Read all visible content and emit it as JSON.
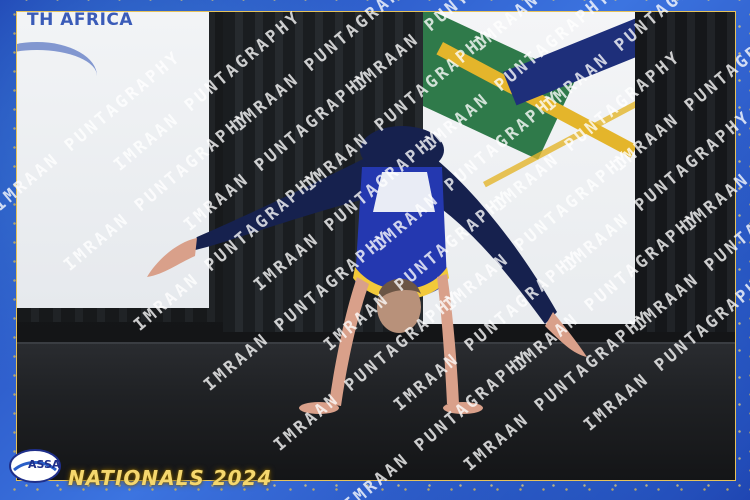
{
  "banner": {
    "left_text": "TH AFRICA"
  },
  "watermark": {
    "text": "IMRAAN PUNTAGRAPHY"
  },
  "logo": {
    "text": "ASSA"
  },
  "event": {
    "title": "NATIONALS 2024"
  },
  "colors": {
    "frame_blue": "#2a5fc8",
    "gold": "#e6c25a",
    "leotard_blue": "#2438b0",
    "navy": "#16214e",
    "yellow_trim": "#f2c93a"
  }
}
